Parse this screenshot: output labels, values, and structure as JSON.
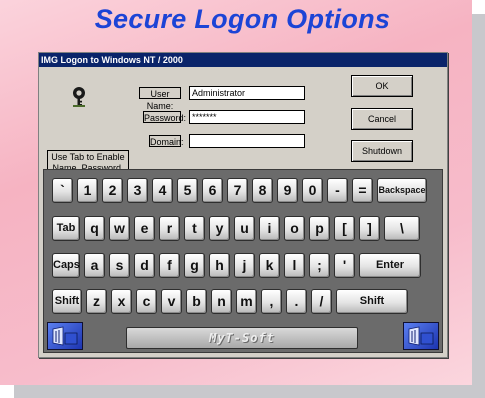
{
  "headline": "Secure Logon Options",
  "window": {
    "title": "IMG Logon to Windows NT / 2000"
  },
  "info_text": "Use Tab to Enable Name, Password, Domain",
  "fields": {
    "username_label": "User Name:",
    "username_value": "Administrator",
    "password_label": "Password:",
    "password_value": "*******",
    "domain_label": "Domain:",
    "domain_value": ""
  },
  "buttons": {
    "ok": "OK",
    "cancel": "Cancel",
    "shutdown": "Shutdown"
  },
  "keyboard": {
    "row1": [
      "`",
      "1",
      "2",
      "3",
      "4",
      "5",
      "6",
      "7",
      "8",
      "9",
      "0",
      "-",
      "=",
      "Backspace"
    ],
    "row2": [
      "Tab",
      "q",
      "w",
      "e",
      "r",
      "t",
      "y",
      "u",
      "i",
      "o",
      "p",
      "[",
      "]",
      "\\"
    ],
    "row3": [
      "Caps",
      "a",
      "s",
      "d",
      "f",
      "g",
      "h",
      "j",
      "k",
      "l",
      ";",
      "'",
      "Enter"
    ],
    "row4": [
      "Shift",
      "z",
      "x",
      "c",
      "v",
      "b",
      "n",
      "m",
      ",",
      ".",
      "/",
      "Shift"
    ],
    "spacebar": "MyT-Soft"
  },
  "icons": {
    "key": "key-icon",
    "windows_key": "windows-key-icon"
  }
}
